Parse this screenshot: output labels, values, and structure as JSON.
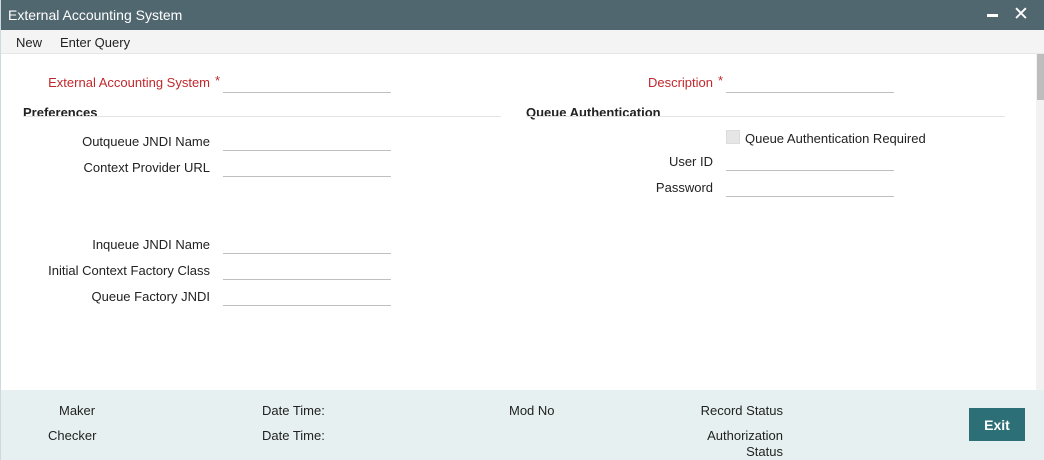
{
  "window": {
    "title": "External Accounting System"
  },
  "menu": {
    "new": "New",
    "enter_query": "Enter Query"
  },
  "header": {
    "system_label": "External Accounting System",
    "description_label": "Description",
    "required_marker": "*"
  },
  "preferences": {
    "title": "Preferences",
    "outqueue_label": "Outqueue JNDI Name",
    "context_url_label": "Context Provider URL",
    "inqueue_label": "Inqueue JNDI Name",
    "initial_ctx_label": "Initial Context Factory Class",
    "queue_factory_label": "Queue Factory JNDI"
  },
  "queue_auth": {
    "title": "Queue Authentication",
    "required_label": "Queue Authentication Required",
    "user_id_label": "User ID",
    "password_label": "Password"
  },
  "footer": {
    "maker": "Maker",
    "checker": "Checker",
    "date_time_1": "Date Time:",
    "date_time_2": "Date Time:",
    "mod_no": "Mod No",
    "record_status": "Record Status",
    "authorization_status_1": "Authorization",
    "authorization_status_2": "Status",
    "exit": "Exit"
  }
}
